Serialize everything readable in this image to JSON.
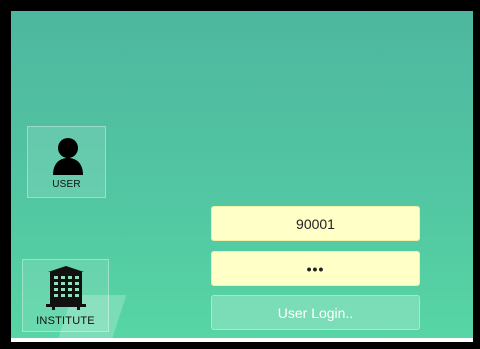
{
  "sidebar": {
    "user_tile": {
      "label": "USER",
      "icon": "user-icon"
    },
    "institute_tile": {
      "label": "INSTITUTE",
      "icon": "building-icon"
    }
  },
  "login": {
    "user_id_value": "90001",
    "password_value": "•••",
    "submit_label": "User Login.."
  },
  "colors": {
    "background_top": "#4eb79f",
    "background_bottom": "#57d6a4",
    "field_bg": "#ffffc8"
  }
}
